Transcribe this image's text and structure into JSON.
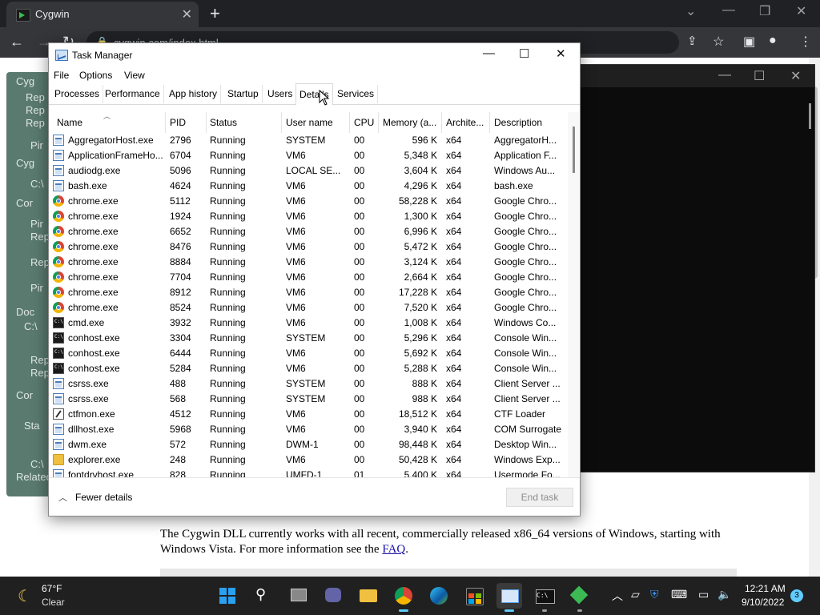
{
  "browser": {
    "tab_title": "Cygwin",
    "url": "cygwin.com/index.html",
    "new_tab": "+",
    "tab_close": "✕"
  },
  "page": {
    "sidebar_lines": [
      "Cyg",
      "Rep",
      "Rep",
      "Rep",
      "Pir",
      "Cyg",
      "C:\\",
      "Cor",
      "Pir",
      "Rep",
      "Rep",
      "Pir",
      "Doc",
      "C:\\",
      "Rep",
      "Rep",
      "Cor",
      "Sta",
      "C:\\",
      "Related"
    ],
    "text_before": "The Cygwin DLL currently works with all recent, commercially released x86_64 versions of Windows, starting with Windows Vista. For more information see the ",
    "faq_link": "FAQ",
    "text_after": "."
  },
  "task_manager": {
    "title": "Task Manager",
    "menu": [
      "File",
      "Options",
      "View"
    ],
    "tabs": [
      "Processes",
      "Performance",
      "App history",
      "Startup",
      "Users",
      "Details",
      "Services"
    ],
    "active_tab": "Details",
    "columns": [
      "Name",
      "PID",
      "Status",
      "User name",
      "CPU",
      "Memory (a...",
      "Archite...",
      "Description"
    ],
    "rows": [
      {
        "icon": "exe",
        "name": "AggregatorHost.exe",
        "pid": "2796",
        "status": "Running",
        "user": "SYSTEM",
        "cpu": "00",
        "mem": "596 K",
        "arch": "x64",
        "desc": "AggregatorH..."
      },
      {
        "icon": "exe",
        "name": "ApplicationFrameHo...",
        "pid": "6704",
        "status": "Running",
        "user": "VM6",
        "cpu": "00",
        "mem": "5,348 K",
        "arch": "x64",
        "desc": "Application F..."
      },
      {
        "icon": "exe",
        "name": "audiodg.exe",
        "pid": "5096",
        "status": "Running",
        "user": "LOCAL SE...",
        "cpu": "00",
        "mem": "3,604 K",
        "arch": "x64",
        "desc": "Windows Au..."
      },
      {
        "icon": "exe",
        "name": "bash.exe",
        "pid": "4624",
        "status": "Running",
        "user": "VM6",
        "cpu": "00",
        "mem": "4,296 K",
        "arch": "x64",
        "desc": "bash.exe"
      },
      {
        "icon": "chrome",
        "name": "chrome.exe",
        "pid": "5112",
        "status": "Running",
        "user": "VM6",
        "cpu": "00",
        "mem": "58,228 K",
        "arch": "x64",
        "desc": "Google Chro..."
      },
      {
        "icon": "chrome",
        "name": "chrome.exe",
        "pid": "1924",
        "status": "Running",
        "user": "VM6",
        "cpu": "00",
        "mem": "1,300 K",
        "arch": "x64",
        "desc": "Google Chro..."
      },
      {
        "icon": "chrome",
        "name": "chrome.exe",
        "pid": "6652",
        "status": "Running",
        "user": "VM6",
        "cpu": "00",
        "mem": "6,996 K",
        "arch": "x64",
        "desc": "Google Chro..."
      },
      {
        "icon": "chrome",
        "name": "chrome.exe",
        "pid": "8476",
        "status": "Running",
        "user": "VM6",
        "cpu": "00",
        "mem": "5,472 K",
        "arch": "x64",
        "desc": "Google Chro..."
      },
      {
        "icon": "chrome",
        "name": "chrome.exe",
        "pid": "8884",
        "status": "Running",
        "user": "VM6",
        "cpu": "00",
        "mem": "3,124 K",
        "arch": "x64",
        "desc": "Google Chro..."
      },
      {
        "icon": "chrome",
        "name": "chrome.exe",
        "pid": "7704",
        "status": "Running",
        "user": "VM6",
        "cpu": "00",
        "mem": "2,664 K",
        "arch": "x64",
        "desc": "Google Chro..."
      },
      {
        "icon": "chrome",
        "name": "chrome.exe",
        "pid": "8912",
        "status": "Running",
        "user": "VM6",
        "cpu": "00",
        "mem": "17,228 K",
        "arch": "x64",
        "desc": "Google Chro..."
      },
      {
        "icon": "chrome",
        "name": "chrome.exe",
        "pid": "8524",
        "status": "Running",
        "user": "VM6",
        "cpu": "00",
        "mem": "7,520 K",
        "arch": "x64",
        "desc": "Google Chro..."
      },
      {
        "icon": "console",
        "name": "cmd.exe",
        "pid": "3932",
        "status": "Running",
        "user": "VM6",
        "cpu": "00",
        "mem": "1,008 K",
        "arch": "x64",
        "desc": "Windows Co..."
      },
      {
        "icon": "console",
        "name": "conhost.exe",
        "pid": "3304",
        "status": "Running",
        "user": "SYSTEM",
        "cpu": "00",
        "mem": "5,296 K",
        "arch": "x64",
        "desc": "Console Win..."
      },
      {
        "icon": "console",
        "name": "conhost.exe",
        "pid": "6444",
        "status": "Running",
        "user": "VM6",
        "cpu": "00",
        "mem": "5,692 K",
        "arch": "x64",
        "desc": "Console Win..."
      },
      {
        "icon": "console",
        "name": "conhost.exe",
        "pid": "5284",
        "status": "Running",
        "user": "VM6",
        "cpu": "00",
        "mem": "5,288 K",
        "arch": "x64",
        "desc": "Console Win..."
      },
      {
        "icon": "exe",
        "name": "csrss.exe",
        "pid": "488",
        "status": "Running",
        "user": "SYSTEM",
        "cpu": "00",
        "mem": "888 K",
        "arch": "x64",
        "desc": "Client Server ..."
      },
      {
        "icon": "exe",
        "name": "csrss.exe",
        "pid": "568",
        "status": "Running",
        "user": "SYSTEM",
        "cpu": "00",
        "mem": "988 K",
        "arch": "x64",
        "desc": "Client Server ..."
      },
      {
        "icon": "pen",
        "name": "ctfmon.exe",
        "pid": "4512",
        "status": "Running",
        "user": "VM6",
        "cpu": "00",
        "mem": "18,512 K",
        "arch": "x64",
        "desc": "CTF Loader"
      },
      {
        "icon": "exe",
        "name": "dllhost.exe",
        "pid": "5968",
        "status": "Running",
        "user": "VM6",
        "cpu": "00",
        "mem": "3,940 K",
        "arch": "x64",
        "desc": "COM Surrogate"
      },
      {
        "icon": "exe",
        "name": "dwm.exe",
        "pid": "572",
        "status": "Running",
        "user": "DWM-1",
        "cpu": "00",
        "mem": "98,448 K",
        "arch": "x64",
        "desc": "Desktop Win..."
      },
      {
        "icon": "folder",
        "name": "explorer.exe",
        "pid": "248",
        "status": "Running",
        "user": "VM6",
        "cpu": "00",
        "mem": "50,428 K",
        "arch": "x64",
        "desc": "Windows Exp..."
      },
      {
        "icon": "exe",
        "name": "fontdrvhost.exe",
        "pid": "828",
        "status": "Running",
        "user": "UMFD-1",
        "cpu": "01",
        "mem": "5,400 K",
        "arch": "x64",
        "desc": "Usermode Fo..."
      }
    ],
    "fewer_details": "Fewer details",
    "end_task": "End task"
  },
  "taskbar": {
    "weather_temp": "67°F",
    "weather_condition": "Clear",
    "time": "12:21 AM",
    "date": "9/10/2022",
    "notification_count": "3"
  }
}
